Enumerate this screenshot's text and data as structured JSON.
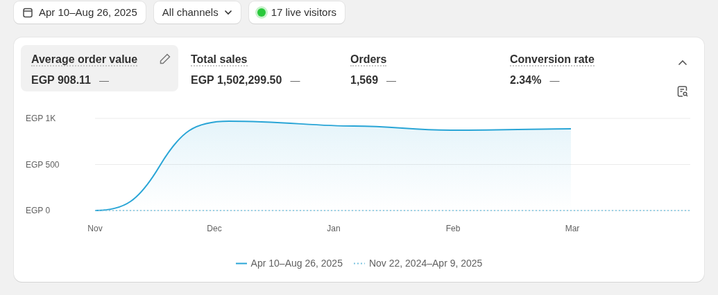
{
  "filters": {
    "date_range": "Apr 10–Aug 26, 2025",
    "channels": "All channels",
    "live_visitors": "17 live visitors"
  },
  "metrics": [
    {
      "label": "Average order value",
      "value": "EGP 908.11",
      "change": "—",
      "selected": true
    },
    {
      "label": "Total sales",
      "value": "EGP 1,502,299.50",
      "change": "—",
      "selected": false
    },
    {
      "label": "Orders",
      "value": "1,569",
      "change": "—",
      "selected": false
    },
    {
      "label": "Conversion rate",
      "value": "2.34%",
      "change": "—",
      "selected": false
    }
  ],
  "chart": {
    "y_axis_labels": [
      "EGP 1K",
      "EGP 500",
      "EGP 0"
    ],
    "x_axis_labels": [
      "Nov",
      "Dec",
      "Jan",
      "Feb",
      "Mar"
    ],
    "legend": [
      {
        "label": "Apr 10–Aug 26, 2025",
        "color": "#29a5d6",
        "kind": "solid"
      },
      {
        "label": "Nov 22, 2024–Apr 9, 2025",
        "color": "#7cc3e0",
        "kind": "dotted"
      }
    ]
  }
}
